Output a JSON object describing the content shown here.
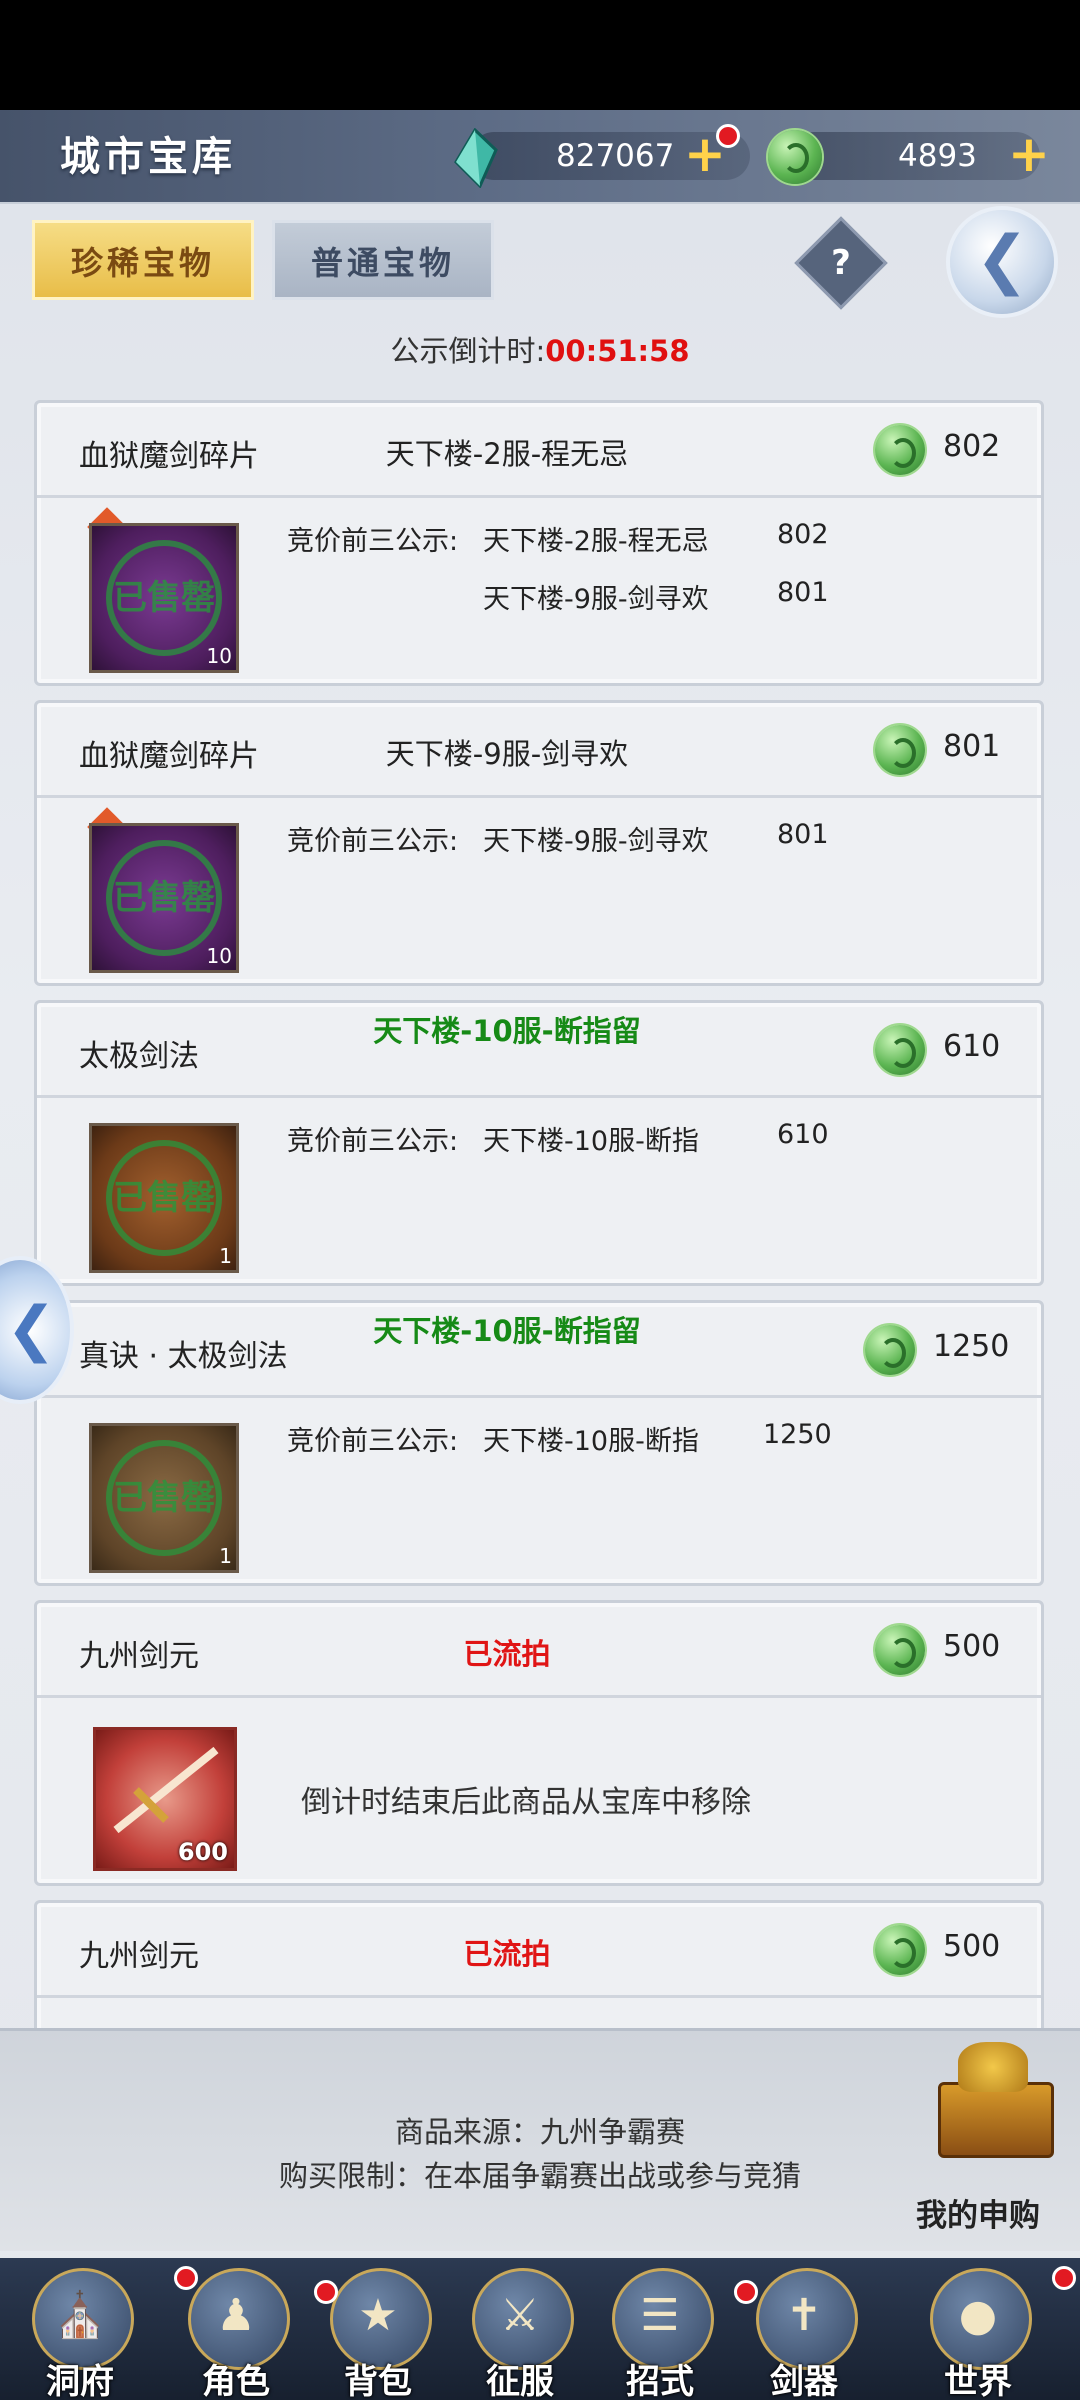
{
  "header": {
    "title": "城市宝库",
    "jade_amount": "827067",
    "coin_amount": "4893",
    "plus": "+"
  },
  "tabs": [
    {
      "label": "珍稀宝物",
      "active": true
    },
    {
      "label": "普通宝物",
      "active": false
    }
  ],
  "help": "?",
  "countdown": {
    "label": "公示倒计时:",
    "time": "00:51:58"
  },
  "items": [
    {
      "name": "血狱魔剑碎片",
      "bidder": "天下楼-2服-程无忌",
      "price": "802",
      "top3_label": "竞价前三公示:",
      "top3": [
        {
          "bidder": "天下楼-2服-程无忌",
          "price": "802"
        },
        {
          "bidder": "天下楼-9服-剑寻欢",
          "price": "801"
        }
      ],
      "qty": "10",
      "stamp": "已售罄"
    },
    {
      "name": "血狱魔剑碎片",
      "bidder": "天下楼-9服-剑寻欢",
      "price": "801",
      "top3_label": "竞价前三公示:",
      "top3": [
        {
          "bidder": "天下楼-9服-剑寻欢",
          "price": "801"
        }
      ],
      "qty": "10",
      "stamp": "已售罄"
    },
    {
      "name": "太极剑法",
      "bidder": "天下楼-10服-断指留",
      "price": "610",
      "top3_label": "竞价前三公示:",
      "top3": [
        {
          "bidder": "天下楼-10服-断指",
          "price": "610"
        }
      ],
      "qty": "1",
      "stamp": "已售罄"
    },
    {
      "name": "真诀 · 太极剑法",
      "bidder": "天下楼-10服-断指留",
      "price": "1250",
      "top3_label": "竞价前三公示:",
      "top3": [
        {
          "bidder": "天下楼-10服-断指",
          "price": "1250"
        }
      ],
      "qty": "1",
      "stamp": "已售罄"
    },
    {
      "name": "九州剑元",
      "bidder": "已流拍",
      "price": "500",
      "note": "倒计时结束后此商品从宝库中移除",
      "qty": "600"
    },
    {
      "name": "九州剑元",
      "bidder": "已流拍",
      "price": "500"
    }
  ],
  "info": {
    "source": "商品来源：九州争霸赛",
    "limit": "购买限制：在本届争霸赛出战或参与竞猜",
    "my_purchase": "我的申购"
  },
  "nav": [
    {
      "label": "洞府",
      "icon": "cave-mansion-icon"
    },
    {
      "label": "角色",
      "icon": "character-icon"
    },
    {
      "label": "背包",
      "icon": "bag-icon"
    },
    {
      "label": "征服",
      "icon": "crossed-swords-icon"
    },
    {
      "label": "招式",
      "icon": "scroll-icon"
    },
    {
      "label": "剑器",
      "icon": "sword-icon"
    },
    {
      "label": "世界",
      "icon": "world-map-icon"
    }
  ],
  "colors": {
    "accent_gold": "#e8bd48",
    "bid_green": "#168a16",
    "alert_red": "#e01010"
  }
}
